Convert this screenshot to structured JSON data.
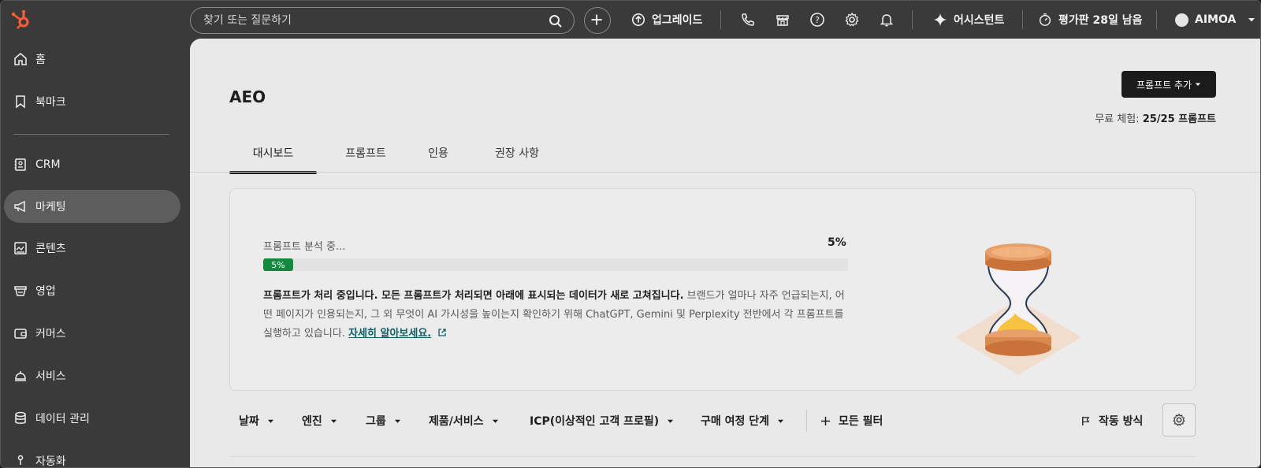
{
  "topbar": {
    "search_placeholder": "찾기 또는 질문하기",
    "upgrade_label": "업그레이드",
    "assistant_label": "어시스턴트",
    "trial_label": "평가판 28일 남음",
    "account_label": "AIMOA"
  },
  "sidebar": {
    "items": [
      {
        "label": "홈",
        "icon": "home-icon"
      },
      {
        "label": "북마크",
        "icon": "bookmark-icon"
      },
      {
        "label": "CRM",
        "icon": "contacts-icon"
      },
      {
        "label": "마케팅",
        "icon": "megaphone-icon"
      },
      {
        "label": "콘텐츠",
        "icon": "content-icon"
      },
      {
        "label": "영업",
        "icon": "sales-icon"
      },
      {
        "label": "커머스",
        "icon": "commerce-icon"
      },
      {
        "label": "서비스",
        "icon": "service-icon"
      },
      {
        "label": "데이터 관리",
        "icon": "database-icon"
      },
      {
        "label": "자동화",
        "icon": "automation-icon"
      }
    ],
    "active_index": 3
  },
  "page": {
    "title": "AEO",
    "add_prompt_label": "프롬프트 추가",
    "trial_prefix": "무료 체험: ",
    "trial_value": "25/25 프롬프트"
  },
  "tabs": [
    {
      "label": "대시보드",
      "active": true
    },
    {
      "label": "프롬프트",
      "active": false
    },
    {
      "label": "인용",
      "active": false
    },
    {
      "label": "권장 사항",
      "active": false
    }
  ],
  "status_card": {
    "analyzing_label": "프롬프트 분석 중...",
    "percent_label": "5%",
    "progress_fraction": 0.05,
    "bar_label": "5%",
    "desc_bold": "프롬프트가 처리 중입니다. 모든 프롬프트가 처리되면 아래에 표시되는 데이터가 새로 고쳐집니다.",
    "desc_rest": " 브랜드가 얼마나 자주 언급되는지, 어떤 페이지가 인용되는지, 그 외 무엇이 AI 가시성을 높이는지 확인하기 위해 ChatGPT, Gemini 및 Perplexity 전반에서 각 프롬프트를 실행하고 있습니다. ",
    "learn_more": "자세히 알아보세요."
  },
  "filters": [
    {
      "label": "날짜"
    },
    {
      "label": "엔진"
    },
    {
      "label": "그룹"
    },
    {
      "label": "제품/서비스"
    },
    {
      "label": "ICP(이상적인 고객 프로필)"
    },
    {
      "label": "구매 여정 단계"
    }
  ],
  "all_filters_label": "모든 필터",
  "how_it_works_label": "작동 방식",
  "colors": {
    "accent_green": "#12893f",
    "link_teal": "#0e5f67",
    "logo_orange": "#ff5c35"
  }
}
